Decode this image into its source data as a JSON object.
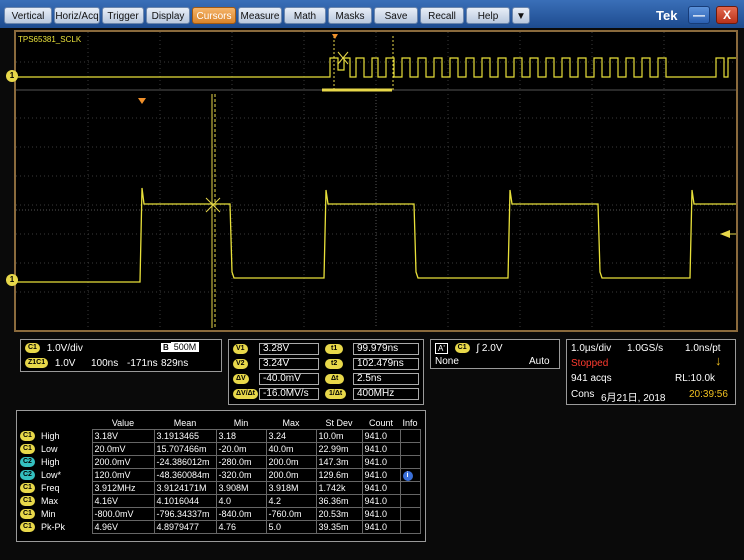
{
  "menu": {
    "items": [
      "Vertical",
      "Horiz/Acq",
      "Trigger",
      "Display",
      "Cursors",
      "Measure",
      "Math",
      "Masks",
      "Save",
      "Recall",
      "Help"
    ],
    "active": "Cursors",
    "dropdown": "▼",
    "brand": "Tek",
    "minimize": "—",
    "close": "X"
  },
  "waveform": {
    "zoom_label": "TPS65381_SCLK",
    "ch_marker": "1"
  },
  "vertical_panel": {
    "c1_badge": "C1",
    "c1_scale": "1.0V/div",
    "cursor_icon_text": "B",
    "bw": "500M",
    "z1c1_badge": "Z1C1",
    "z_volts": "1.0V",
    "z_time": "100ns",
    "z_pos": "-171ns",
    "z_width": "829ns"
  },
  "cursor_panel": {
    "v1_label": "V1",
    "v1": "3.28V",
    "v2_label": "V2",
    "v2": "3.24V",
    "dv_label": "ΔV",
    "dv": "-40.0mV",
    "dvdt_label": "ΔV/Δt",
    "dvdt": "-16.0MV/s",
    "t1_label": "t1",
    "t1": "99.979ns",
    "t2_label": "t2",
    "t2": "102.479ns",
    "dt_label": "Δt",
    "dt": "2.5ns",
    "invdt_label": "1/Δt",
    "invdt": "400MHz"
  },
  "trigger_panel": {
    "a_label": "A'",
    "c1": "C1",
    "slope": "∫",
    "level": "2.0V",
    "coupling": "None",
    "mode": "Auto"
  },
  "acq_panel": {
    "hscale": "1.0µs/div",
    "rate": "1.0GS/s",
    "res": "1.0ns/pt",
    "state": "Stopped",
    "acqs": "941 acqs",
    "rl": "RL:10.0k",
    "cons": "Cons",
    "date": "6月21日, 2018",
    "time": "20:39:56"
  },
  "measurements": {
    "headers": [
      "Value",
      "Mean",
      "Min",
      "Max",
      "St Dev",
      "Count",
      "Info"
    ],
    "rows": [
      {
        "ch": "C1",
        "name": "High",
        "value": "3.18V",
        "mean": "3.1913465",
        "min": "3.18",
        "max": "3.24",
        "std": "10.0m",
        "count": "941.0"
      },
      {
        "ch": "C1",
        "name": "Low",
        "value": "20.0mV",
        "mean": "15.707466m",
        "min": "-20.0m",
        "max": "40.0m",
        "std": "22.99m",
        "count": "941.0"
      },
      {
        "ch": "C2",
        "name": "High",
        "value": "200.0mV",
        "mean": "-24.386012m",
        "min": "-280.0m",
        "max": "200.0m",
        "std": "147.3m",
        "count": "941.0"
      },
      {
        "ch": "C2",
        "name": "Low*",
        "value": "120.0mV",
        "mean": "-48.360084m",
        "min": "-320.0m",
        "max": "200.0m",
        "std": "129.6m",
        "count": "941.0"
      },
      {
        "ch": "C1",
        "name": "Freq",
        "value": "3.912MHz",
        "mean": "3.9124171M",
        "min": "3.908M",
        "max": "3.918M",
        "std": "1.742k",
        "count": "941.0"
      },
      {
        "ch": "C1",
        "name": "Max",
        "value": "4.16V",
        "mean": "4.1016044",
        "min": "4.0",
        "max": "4.2",
        "std": "36.36m",
        "count": "941.0"
      },
      {
        "ch": "C1",
        "name": "Min",
        "value": "-800.0mV",
        "mean": "-796.34337m",
        "min": "-840.0m",
        "max": "-760.0m",
        "std": "20.53m",
        "count": "941.0"
      },
      {
        "ch": "C1",
        "name": "Pk-Pk",
        "value": "4.96V",
        "mean": "4.8979477",
        "min": "4.76",
        "max": "5.0",
        "std": "39.35m",
        "count": "941.0"
      }
    ],
    "info_icon": "info-icon"
  },
  "colors": {
    "trace": "#e8e03a",
    "cursor": "#e8d84a",
    "stopped": "#ff3b2f",
    "time": "#f0c020"
  }
}
